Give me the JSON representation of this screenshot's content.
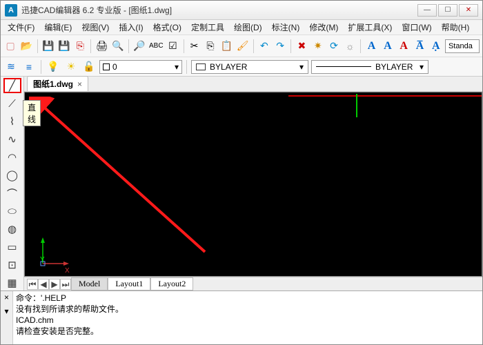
{
  "window": {
    "appicon_letter": "A",
    "title": "迅捷CAD编辑器 6.2 专业版  - [图纸1.dwg]"
  },
  "menu": {
    "file": "文件(F)",
    "edit": "编辑(E)",
    "view": "视图(V)",
    "insert": "插入(I)",
    "format": "格式(O)",
    "custom": "定制工具",
    "draw": "绘图(D)",
    "annot": "标注(N)",
    "modify": "修改(M)",
    "ext": "扩展工具(X)",
    "window": "窗口(W)",
    "help": "帮助(H)"
  },
  "toolbar": {
    "styleLabel": "Standa"
  },
  "layer": {
    "current": "0",
    "bylayer1": "BYLAYER",
    "bylayer2": "BYLAYER"
  },
  "doc_tab": {
    "name": "图纸1.dwg"
  },
  "tooltip": {
    "line": "直线"
  },
  "axes": {
    "x": "X",
    "y": "Y"
  },
  "model_tabs": {
    "model": "Model",
    "l1": "Layout1",
    "l2": "Layout2"
  },
  "cmd": {
    "l1": "命令：'.HELP",
    "l2": "没有找到所请求的帮助文件。",
    "l3": "ICAD.chm",
    "l4": "请检查安装是否完整。"
  }
}
